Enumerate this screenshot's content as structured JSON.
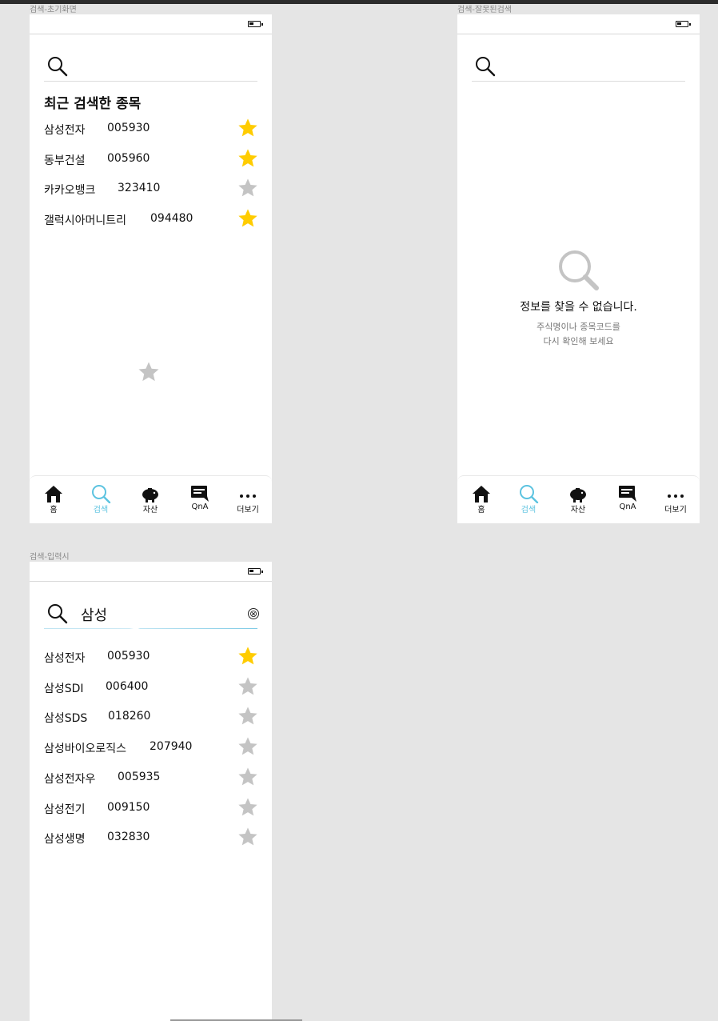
{
  "frames": {
    "initial": {
      "label": "검색-초기화면",
      "section_title": "최근 검색한 종목",
      "items": [
        {
          "name": "삼성전자",
          "code": "005930",
          "favorite": true
        },
        {
          "name": "동부건설",
          "code": "005960",
          "favorite": true
        },
        {
          "name": "카카오뱅크",
          "code": "323410",
          "favorite": false
        },
        {
          "name": "갤럭시아머니트리",
          "code": "094480",
          "favorite": true
        }
      ]
    },
    "invalid": {
      "label": "검색-잘못된검색",
      "empty_title": "정보를 찾을 수 없습니다.",
      "empty_line1": "주식명이나 종목코드를",
      "empty_line2": "다시 확인해 보세요"
    },
    "typing": {
      "label": "검색-입력시",
      "query": "삼성",
      "clear_icon": "⊗",
      "items": [
        {
          "name": "삼성전자",
          "code": "005930",
          "favorite": true
        },
        {
          "name": "삼성SDI",
          "code": "006400",
          "favorite": false
        },
        {
          "name": "삼성SDS",
          "code": "018260",
          "favorite": false
        },
        {
          "name": "삼성바이오로직스",
          "code": "207940",
          "favorite": false
        },
        {
          "name": "삼성전자우",
          "code": "005935",
          "favorite": false
        },
        {
          "name": "삼성전기",
          "code": "009150",
          "favorite": false
        },
        {
          "name": "삼성생명",
          "code": "032830",
          "favorite": false
        }
      ]
    }
  },
  "nav": {
    "home": "홈",
    "search": "검색",
    "assets": "자산",
    "qna": "QnA",
    "more": "더보기"
  },
  "colors": {
    "star_on": "#FFCC00",
    "star_off": "#C4C4C4",
    "accent": "#5CC3E0"
  },
  "icons": [
    "search-icon",
    "star-icon",
    "battery-icon",
    "home-icon",
    "piggy-bank-icon",
    "chat-icon",
    "more-icon",
    "clear-icon"
  ]
}
